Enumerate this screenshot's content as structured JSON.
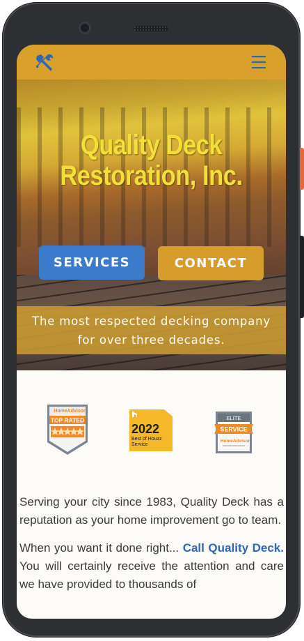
{
  "site": {
    "title_line1": "Quality Deck",
    "title_line2": "Restoration, Inc.",
    "services_label": "SERVICES",
    "contact_label": "CONTACT",
    "tagline": "The most respected decking company\nfor over three decades."
  },
  "topbar": {
    "logo_icon": "tools-icon",
    "menu_icon": "hamburger-menu-icon",
    "bar_color": "#d9a02b",
    "icon_color": "#2f67b1"
  },
  "badges": {
    "homeadvisor_top_brand": "HomeAdvisor",
    "homeadvisor_top_label": "TOP RATED",
    "houzz_year": "2022",
    "houzz_line1": "Best of Houzz",
    "houzz_line2": "Service",
    "elite_top": "ELITE",
    "elite_label": "SERVICE",
    "elite_brand": "HomeAdvisor"
  },
  "body": {
    "para1": "Serving your city since 1983, Quality Deck has a reputation as your home improvement go to team.",
    "para2_start": "When you want it done right... ",
    "para2_link": "Call Quality Deck.",
    "para2_end": " You will certainly receive the attention and care we have provided to thousands of"
  },
  "colors": {
    "services_button": "#3b7bc9",
    "contact_button": "#d79d2c",
    "title_text": "#f2df3a",
    "link_text": "#2f67b1"
  }
}
